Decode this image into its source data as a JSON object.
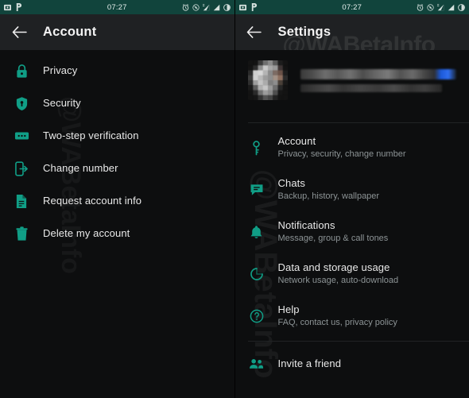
{
  "statusbar": {
    "clock": "07:27",
    "left_icons": [
      "screenshot-icon",
      "pandora-icon"
    ],
    "right_icons": [
      "alarm-icon",
      "wifi-icon",
      "signal-icon-1",
      "signal-icon-2",
      "battery-icon"
    ],
    "background": "#11443c"
  },
  "watermark": {
    "main": "@WABetaInfo",
    "vertical": "@WABetaInfo"
  },
  "theme": {
    "accent": "#0f7a6b",
    "icon_teal": "#109e86",
    "title_color": "#e9e9e9",
    "subtitle_color": "#8d9496",
    "appbar_bg": "#1f2123",
    "page_bg": "#0d0e0f"
  },
  "left_panel": {
    "appbar": {
      "title": "Account",
      "back_icon": "back-arrow-icon"
    },
    "items": [
      {
        "label": "Privacy",
        "icon": "lock-icon"
      },
      {
        "label": "Security",
        "icon": "shield-icon"
      },
      {
        "label": "Two-step verification",
        "icon": "pin-code-icon"
      },
      {
        "label": "Change number",
        "icon": "change-number-icon"
      },
      {
        "label": "Request account info",
        "icon": "document-icon"
      },
      {
        "label": "Delete my account",
        "icon": "trash-icon"
      }
    ]
  },
  "right_panel": {
    "appbar": {
      "title": "Settings",
      "back_icon": "back-arrow-icon"
    },
    "profile": {
      "avatar": "blurred-profile-photo",
      "name_redacted": true,
      "status_redacted": true
    },
    "items": [
      {
        "label": "Account",
        "sub": "Privacy, security, change number",
        "icon": "key-icon"
      },
      {
        "label": "Chats",
        "sub": "Backup, history, wallpaper",
        "icon": "chat-icon"
      },
      {
        "label": "Notifications",
        "sub": "Message, group & call tones",
        "icon": "bell-icon"
      },
      {
        "label": "Data and storage usage",
        "sub": "Network usage, auto-download",
        "icon": "data-usage-icon"
      },
      {
        "label": "Help",
        "sub": "FAQ, contact us, privacy policy",
        "icon": "help-icon"
      }
    ],
    "footer": {
      "label": "Invite a friend",
      "icon": "people-icon"
    }
  }
}
